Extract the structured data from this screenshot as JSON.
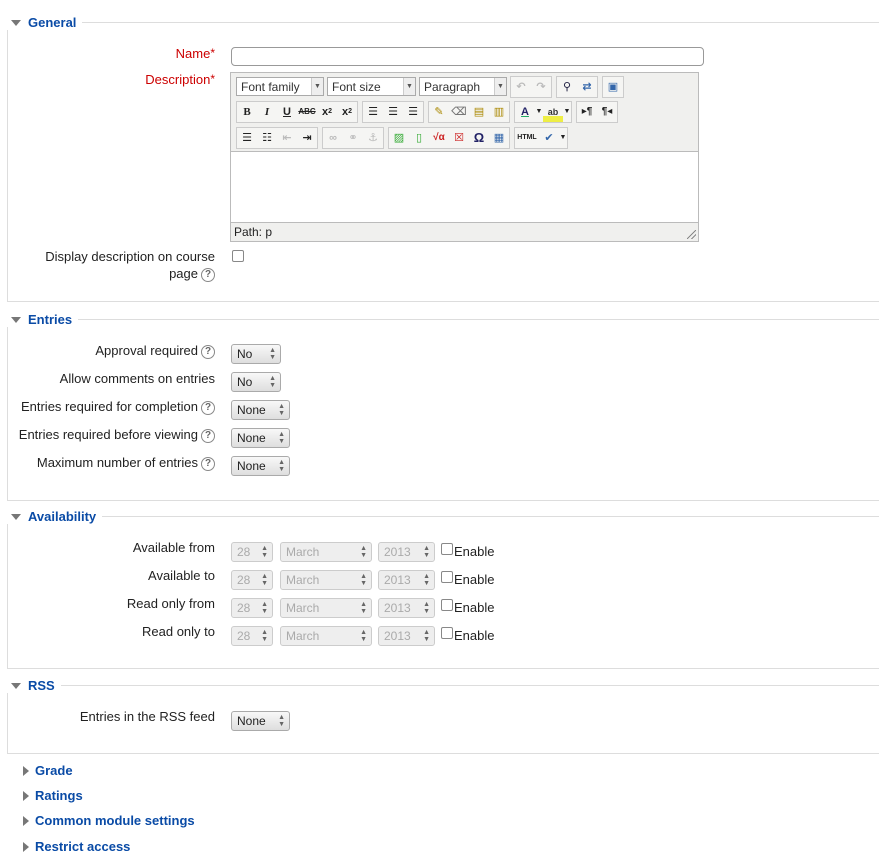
{
  "sections": {
    "general": "General",
    "entries": "Entries",
    "availability": "Availability",
    "rss": "RSS"
  },
  "general": {
    "name_label": "Name",
    "description_label": "Description",
    "display_desc_label_1": "Display description on course",
    "display_desc_label_2": "page",
    "editor": {
      "font_family": "Font family",
      "font_size": "Font size",
      "paragraph": "Paragraph",
      "path": "Path: p"
    }
  },
  "entries": {
    "approval_label": "Approval required",
    "approval_value": "No",
    "comments_label": "Allow comments on entries",
    "comments_value": "No",
    "completion_label": "Entries required for completion",
    "completion_value": "None",
    "viewing_label": "Entries required before viewing",
    "viewing_value": "None",
    "max_label": "Maximum number of entries",
    "max_value": "None"
  },
  "availability": {
    "rows": [
      {
        "label": "Available from",
        "day": "28",
        "month": "March",
        "year": "2013",
        "enable": "Enable"
      },
      {
        "label": "Available to",
        "day": "28",
        "month": "March",
        "year": "2013",
        "enable": "Enable"
      },
      {
        "label": "Read only from",
        "day": "28",
        "month": "March",
        "year": "2013",
        "enable": "Enable"
      },
      {
        "label": "Read only to",
        "day": "28",
        "month": "March",
        "year": "2013",
        "enable": "Enable"
      }
    ]
  },
  "rss": {
    "feed_label": "Entries in the RSS feed",
    "feed_value": "None"
  },
  "collapsed": {
    "grade": "Grade",
    "ratings": "Ratings",
    "common": "Common module settings",
    "restrict": "Restrict access"
  },
  "icons": {
    "help": "?",
    "omega": "Ω",
    "html": "HTML"
  }
}
